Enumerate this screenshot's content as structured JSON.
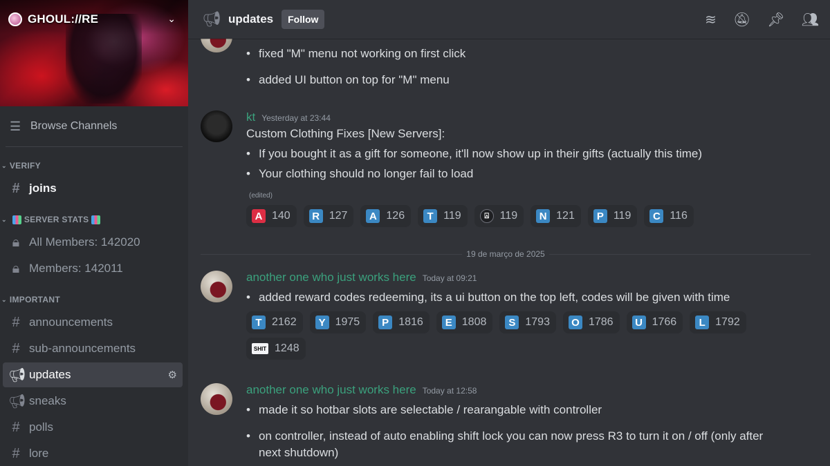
{
  "server": {
    "name": "GHOUL://RE",
    "chevron_icon": "chevron-down-icon"
  },
  "sidebar": {
    "browse_label": "Browse Channels",
    "categories": [
      {
        "name": "VERIFY",
        "channels": [
          {
            "label": "joins"
          }
        ]
      },
      {
        "name": "SERVER STATS",
        "channels": [
          {
            "label": "All Members: 142020"
          },
          {
            "label": "Members: 142011"
          }
        ]
      },
      {
        "name": "IMPORTANT",
        "channels": [
          {
            "label": "announcements"
          },
          {
            "label": "sub-announcements"
          },
          {
            "label": "updates"
          },
          {
            "label": "sneaks"
          },
          {
            "label": "polls"
          },
          {
            "label": "lore"
          }
        ]
      }
    ]
  },
  "header": {
    "channel": "updates",
    "follow_label": "Follow",
    "icons": [
      "threads-icon",
      "notification-mute-icon",
      "pin-icon",
      "members-icon"
    ]
  },
  "messages": [
    {
      "bullets": [
        "fixed \"M\" menu not working on first click",
        "added UI button on top for \"M\" menu"
      ]
    },
    {
      "author": "kt",
      "time": "Yesterday at 23:44",
      "text": "Custom Clothing Fixes [New Servers]:",
      "bullets": [
        "If you bought it as a gift for someone, it'll now show up in their gifts (actually this time)",
        "Your clothing should no longer fail to load"
      ],
      "edited": "(edited)",
      "reactions": [
        {
          "emoji": "A",
          "count": "140",
          "color": "#dd2e44"
        },
        {
          "emoji": "R",
          "count": "127",
          "color": "#3b88c3"
        },
        {
          "emoji": "A",
          "count": "126",
          "color": "#3b88c3"
        },
        {
          "emoji": "T",
          "count": "119",
          "color": "#3b88c3"
        },
        {
          "emoji": "⍓",
          "count": "119",
          "color": "#1e1f22"
        },
        {
          "emoji": "N",
          "count": "121",
          "color": "#3b88c3"
        },
        {
          "emoji": "P",
          "count": "119",
          "color": "#3b88c3"
        },
        {
          "emoji": "C",
          "count": "116",
          "color": "#3b88c3"
        }
      ]
    },
    {
      "author": "another one who just works here",
      "time": "Today at 09:21",
      "bullets": [
        "added reward codes redeeming, its a ui button on the top left, codes will be given with time"
      ],
      "reactions": [
        {
          "emoji": "T",
          "count": "2162"
        },
        {
          "emoji": "Y",
          "count": "1975"
        },
        {
          "emoji": "P",
          "count": "1816"
        },
        {
          "emoji": "E",
          "count": "1808"
        },
        {
          "emoji": "S",
          "count": "1793"
        },
        {
          "emoji": "O",
          "count": "1786"
        },
        {
          "emoji": "U",
          "count": "1766"
        },
        {
          "emoji": "L",
          "count": "1792"
        },
        {
          "emoji": "SHIT",
          "count": "1248"
        }
      ]
    },
    {
      "author": "another one who just works here",
      "time": "Today at 12:58",
      "bullets": [
        "made it so hotbar slots are selectable / rearangable with controller",
        "on controller, instead of auto enabling shift lock you can now press  R3 to turn it on / off (only after next shutdown)"
      ]
    }
  ],
  "date_divider": "19 de março de 2025"
}
